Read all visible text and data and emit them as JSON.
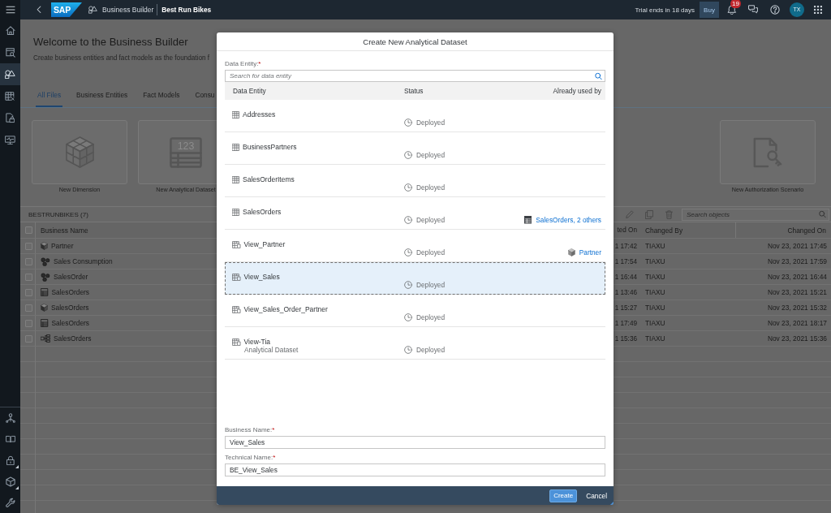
{
  "side_nav": {
    "items": [
      {
        "selected": false
      },
      {
        "selected": false
      },
      {
        "selected": true
      },
      {
        "selected": false
      },
      {
        "selected": false
      },
      {
        "selected": false
      }
    ],
    "bottom_items": [
      {
        "selected": false,
        "expandable": false
      },
      {
        "selected": false,
        "expandable": false
      },
      {
        "selected": false,
        "expandable": true
      },
      {
        "selected": false,
        "expandable": true
      },
      {
        "selected": false,
        "expandable": false
      }
    ]
  },
  "shell_bar": {
    "logo": "SAP",
    "app_title": "Business Builder",
    "space_name": "Best Run Bikes",
    "trial_notice": "Trial ends in 18 days",
    "buy_button": "Buy",
    "notification_count": "19",
    "avatar_initials": "TX"
  },
  "page": {
    "title": "Welcome to the Business Builder",
    "subtitle": "Create business entities and fact models as the foundation f",
    "tabs": [
      {
        "label": "All Files",
        "selected": true
      },
      {
        "label": "Business Entities",
        "selected": false
      },
      {
        "label": "Fact Models",
        "selected": false
      },
      {
        "label": "Consu",
        "selected": false
      }
    ],
    "tiles": [
      {
        "kind": "dimension",
        "label": "New Dimension"
      },
      {
        "kind": "dataset",
        "label": "New Analytical Dataset",
        "icon_text": "123"
      },
      {
        "kind": "authorization",
        "label": "New Authorization Scenario"
      }
    ]
  },
  "files_table": {
    "title": "BESTRUNBIKES (7)",
    "search_placeholder": "Search objects",
    "select_all_checked": false,
    "columns": [
      "Business Name",
      "ted On",
      "Changed By",
      "Changed On"
    ],
    "rows": [
      {
        "kind": "dimension",
        "checked": false,
        "business_name": "Partner",
        "created_on": "1 17:42",
        "changed_by": "TIAXU",
        "changed_on": "Nov 23, 2021 17:45"
      },
      {
        "kind": "consumption",
        "checked": false,
        "business_name": "Sales Consumption",
        "created_on": "1 17:54",
        "changed_by": "TIAXU",
        "changed_on": "Nov 23, 2021 17:59"
      },
      {
        "kind": "consumption",
        "checked": false,
        "business_name": "SalesOrder",
        "created_on": "1 16:44",
        "changed_by": "TIAXU",
        "changed_on": "Nov 23, 2021 16:44"
      },
      {
        "kind": "dataset",
        "checked": false,
        "business_name": "SalesOrders",
        "created_on": "1 13:46",
        "changed_by": "TIAXU",
        "changed_on": "Nov 23, 2021 15:21"
      },
      {
        "kind": "dimension",
        "checked": false,
        "business_name": "SalesOrders",
        "created_on": "1 15:27",
        "changed_by": "TIAXU",
        "changed_on": "Nov 23, 2021 15:32"
      },
      {
        "kind": "dataset",
        "checked": false,
        "business_name": "SalesOrders",
        "created_on": "1 17:49",
        "changed_by": "TIAXU",
        "changed_on": "Nov 23, 2021 18:17"
      },
      {
        "kind": "fact",
        "checked": false,
        "business_name": "SalesOrders",
        "created_on": "1 15:36",
        "changed_by": "TIAXU",
        "changed_on": "Nov 23, 2021 15:36"
      }
    ]
  },
  "dialog": {
    "title": "Create New Analytical Dataset",
    "entity_field": {
      "label": "Data Entity:",
      "required_mark": "*",
      "placeholder": "Search for data entity"
    },
    "columns": [
      "Data Entity",
      "Status",
      "Already used by"
    ],
    "rows": [
      {
        "kind": "table",
        "name": "Addresses",
        "status": "Deployed",
        "selected": false
      },
      {
        "kind": "table",
        "name": "BusinessPartners",
        "status": "Deployed",
        "selected": false
      },
      {
        "kind": "table",
        "name": "SalesOrderItems",
        "status": "Deployed",
        "selected": false
      },
      {
        "kind": "table",
        "name": "SalesOrders",
        "status": "Deployed",
        "used_by": {
          "kind": "dataset",
          "text": "SalesOrders, 2 others"
        },
        "selected": false
      },
      {
        "kind": "view",
        "name": "View_Partner",
        "status": "Deployed",
        "used_by": {
          "kind": "dimension",
          "text": "Partner"
        },
        "selected": false
      },
      {
        "kind": "view",
        "name": "View_Sales",
        "status": "Deployed",
        "selected": true
      },
      {
        "kind": "view",
        "name": "View_Sales_Order_Partner",
        "status": "Deployed",
        "selected": false
      },
      {
        "kind": "view",
        "name": "View-Tia",
        "subtitle": "Analytical Dataset",
        "status": "Deployed",
        "selected": false
      }
    ],
    "business_name": {
      "label": "Business Name:",
      "required_mark": "*",
      "value": "View_Sales"
    },
    "technical_name": {
      "label": "Technical Name:",
      "required_mark": "*",
      "value": "BE_View_Sales"
    },
    "buttons": [
      {
        "kind": "primary",
        "label": "Create"
      },
      {
        "kind": "secondary",
        "label": "Cancel"
      }
    ]
  }
}
